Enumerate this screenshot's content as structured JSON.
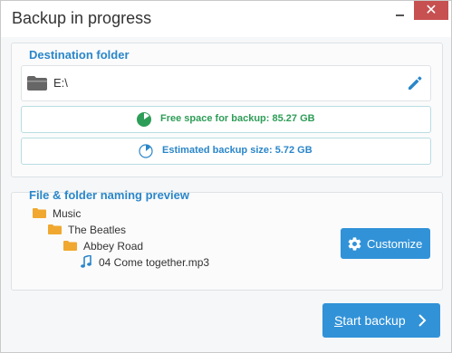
{
  "window": {
    "title": "Backup in progress",
    "close_glyph": "✕"
  },
  "destination": {
    "section_title": "Destination folder",
    "path": "E:\\",
    "folder_icon": "folder-icon",
    "edit_icon": "pencil-icon",
    "free_space_text": "Free space for backup: 85.27 GB",
    "free_space_color": "#2e9d57",
    "estimated_size_text": "Estimated backup size: 5.72 GB",
    "estimated_size_color": "#2a86c9"
  },
  "preview": {
    "section_title": "File & folder naming preview",
    "tree": [
      {
        "name": "Music",
        "icon": "folder-icon"
      },
      {
        "name": "The Beatles",
        "icon": "folder-icon"
      },
      {
        "name": "Abbey Road",
        "icon": "folder-icon"
      },
      {
        "name": "04 Come together.mp3",
        "icon": "music-note-icon"
      }
    ],
    "customize_label": "Customize"
  },
  "footer": {
    "start_label_first": "S",
    "start_label_rest": "tart backup"
  },
  "colors": {
    "accent": "#2a86c9",
    "button": "#3192d8",
    "close": "#c75050",
    "folder": "#f0a830"
  }
}
